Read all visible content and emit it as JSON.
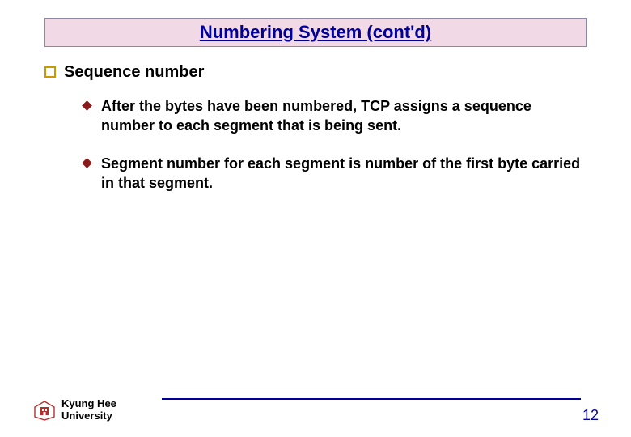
{
  "slide": {
    "title": "Numbering System (cont'd)",
    "section_label": "Sequence number",
    "bullets": [
      "After the bytes have been numbered, TCP assigns a sequence number to each segment that is being sent.",
      "Segment number for each segment is number of the first byte carried in that segment."
    ],
    "footer": {
      "university_line1": "Kyung Hee",
      "university_line2": "University",
      "page_number": "12"
    }
  }
}
